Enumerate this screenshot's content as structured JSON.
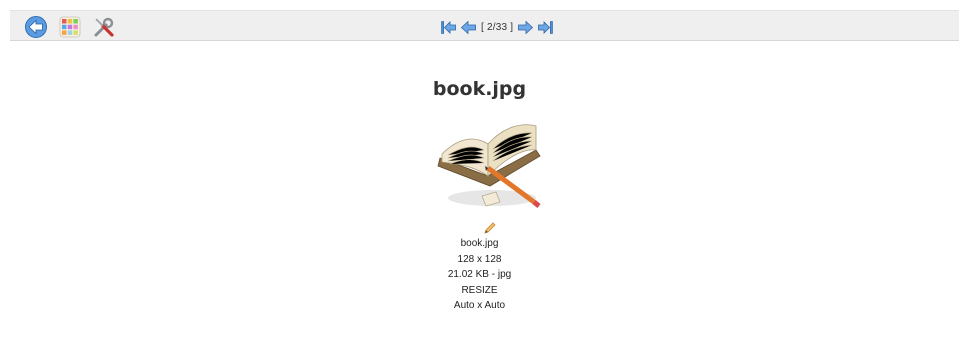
{
  "toolbar": {
    "icons": [
      "back-arrow-icon",
      "color-palette-icon",
      "tools-wrench-screwdriver-icon"
    ],
    "colors": {
      "background": "#efefef",
      "nav_arrow": "#4f8fd8"
    }
  },
  "pager": {
    "counter": "[ 2/33 ]",
    "icons": [
      "first-page-icon",
      "previous-page-icon",
      "next-page-icon",
      "last-page-icon"
    ]
  },
  "image": {
    "title": "book.jpg",
    "thumbnail_icon": "open-book-with-pencil-and-eraser",
    "edit_icon": "pencil-icon",
    "filename": "book.jpg",
    "dimensions": "128 x 128",
    "size_type": "21.02 KB - jpg",
    "resize_label": "RESIZE",
    "resize_value": "Auto x Auto"
  }
}
